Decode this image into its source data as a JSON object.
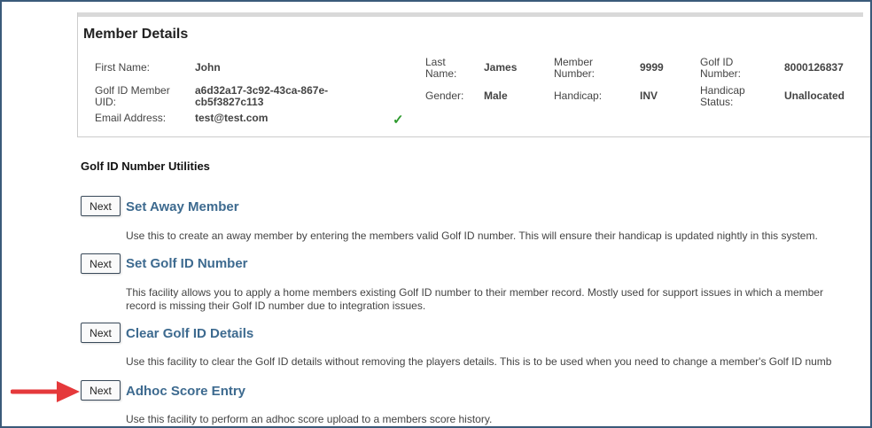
{
  "member_details": {
    "title": "Member Details",
    "first_name_label": "First Name:",
    "first_name": "John",
    "golf_id_uid_label": "Golf ID Member\nUID:",
    "golf_id_uid": "a6d32a17-3c92-43ca-867e-\ncb5f3827c113",
    "email_label": "Email Address:",
    "email": "test@test.com",
    "email_verified_icon": "check-icon",
    "last_name_label": "Last\nName:",
    "last_name": "James",
    "gender_label": "Gender:",
    "gender": "Male",
    "member_number_label": "Member\nNumber:",
    "member_number": "9999",
    "handicap_label": "Handicap:",
    "handicap": "INV",
    "golf_id_number_label": "Golf ID\nNumber:",
    "golf_id_number": "8000126837",
    "handicap_status_label": "Handicap\nStatus:",
    "handicap_status": "Unallocated"
  },
  "utilities": {
    "title": "Golf ID Number Utilities",
    "items": [
      {
        "button_label": "Next",
        "title": "Set Away Member",
        "description": "Use this to create an away member by entering the members valid Golf ID number. This will ensure their handicap is updated nightly in this system."
      },
      {
        "button_label": "Next",
        "title": "Set Golf ID Number",
        "description_line1": "This facility allows you to apply a home members existing Golf ID number to their member record. Mostly used for support issues in which a member",
        "description_line2": "record is missing their Golf ID number due to integration issues."
      },
      {
        "button_label": "Next",
        "title": "Clear Golf ID Details",
        "description": "Use this facility to clear the Golf ID details without removing the players details. This is to be used when you need to change a member's Golf ID numb"
      },
      {
        "button_label": "Next",
        "title": "Adhoc Score Entry",
        "description": "Use this facility to perform an adhoc score upload to a members score history."
      }
    ]
  },
  "colors": {
    "frame_border": "#3a5a7a",
    "link_title": "#3d6a8f",
    "arrow": "#e5393b",
    "check": "#2e9a2e"
  }
}
